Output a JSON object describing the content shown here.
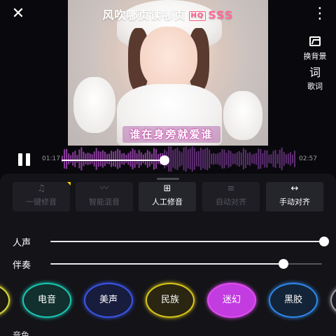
{
  "topbar": {
    "close_icon": "close-icon",
    "more_icon": "more-vertical-icon"
  },
  "video": {
    "title": "风吹哪页读哪页",
    "hq_badge": "HQ",
    "sss_badge": "SSS",
    "lyric_line": "谁在身旁就爱谁"
  },
  "side_tools": [
    {
      "icon": "image-icon",
      "label": "换背景"
    },
    {
      "icon": "lyrics-icon",
      "icon_text": "词",
      "label": "歌词"
    }
  ],
  "player": {
    "state_icon": "pause-icon",
    "current_time": "01:17",
    "total_time": "02:57",
    "progress": 0.44,
    "wave_colors": {
      "played": "#8a3d9c",
      "unplayed": "#5e2e73"
    }
  },
  "modes": [
    {
      "label": "一键修音",
      "icon": "music-note-icon",
      "state": "dim"
    },
    {
      "label": "智能混音",
      "icon": "waveform-icon",
      "state": "dim"
    },
    {
      "label": "人工修音",
      "icon": "tune-icon",
      "state": "active"
    },
    {
      "label": "自动对齐",
      "icon": "auto-align-icon",
      "state": "dim"
    },
    {
      "label": "手动对齐",
      "icon": "manual-align-icon",
      "state": "bright"
    }
  ],
  "sliders": [
    {
      "label": "人声",
      "value": 1.0
    },
    {
      "label": "伴奏",
      "value": 0.85
    }
  ],
  "effects": [
    {
      "label": "",
      "border": "#d8d73a",
      "fill": "#1a1a12"
    },
    {
      "label": "电音",
      "border": "#19c6b2",
      "fill": "#12302d"
    },
    {
      "label": "美声",
      "border": "#3a55e8",
      "fill": "#181d3e"
    },
    {
      "label": "民族",
      "border": "#d9c419",
      "fill": "#2a2612"
    },
    {
      "label": "迷幻",
      "border": "#e14cf2",
      "fill": "#c23ce0"
    },
    {
      "label": "黑胶",
      "border": "#2f86e8",
      "fill": "#142438"
    },
    {
      "label": "",
      "border": "#9a9aa6",
      "fill": "#1a1a20"
    }
  ],
  "section_label": "音色"
}
